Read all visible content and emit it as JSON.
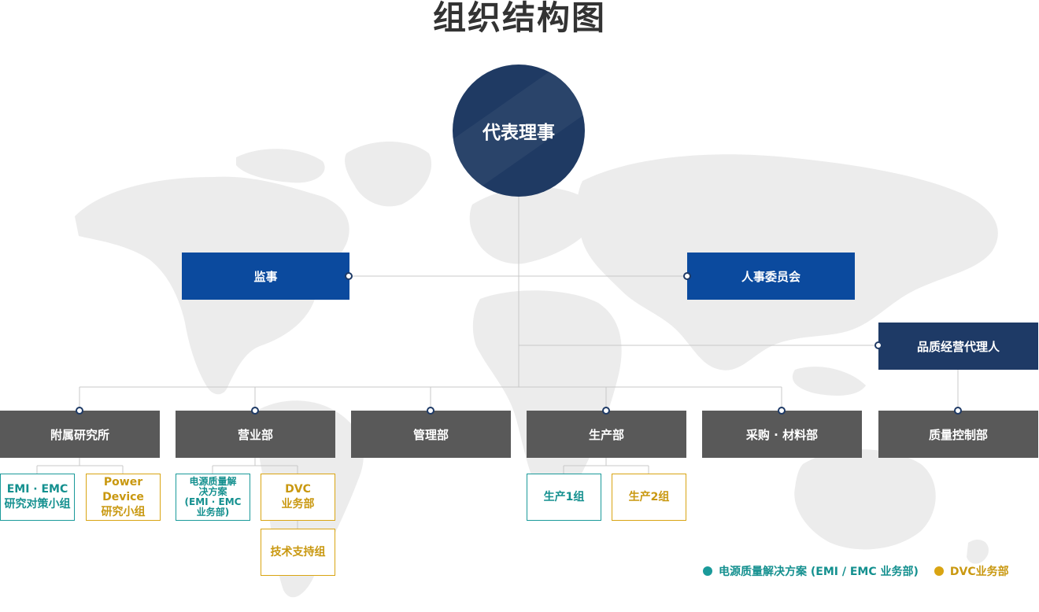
{
  "title": "组织结构图",
  "ceo": "代表理事",
  "supervisor": "监事",
  "hr_committee": "人事委员会",
  "quality_agent": "品质经营代理人",
  "departments": {
    "research": "附属研究所",
    "sales": "营业部",
    "management": "管理部",
    "production": "生产部",
    "purchasing": "采购 · 材料部",
    "quality": "质量控制部"
  },
  "subunits": {
    "emi_research_l1": "EMI · EMC",
    "emi_research_l2": "研究对策小组",
    "power_device_l1": "Power Device",
    "power_device_l2": "研究小组",
    "power_solution_l1": "电源质量解",
    "power_solution_l2": "决方案",
    "power_solution_l3": "(EMI · EMC",
    "power_solution_l4": "业务部)",
    "dvc_l1": "DVC",
    "dvc_l2": "业务部",
    "tech_support": "技术支持组",
    "production_1": "生产1组",
    "production_2": "生产2组"
  },
  "legend": {
    "teal_label": "电源质量解决方案 (EMI / EMC 业务部)",
    "gold_label": "DVC业务部"
  },
  "colors": {
    "teal": "#1a9a9a",
    "gold": "#d9a412",
    "navy": "#1e3a66",
    "blue": "#0b4a9e",
    "gray": "#595959"
  }
}
